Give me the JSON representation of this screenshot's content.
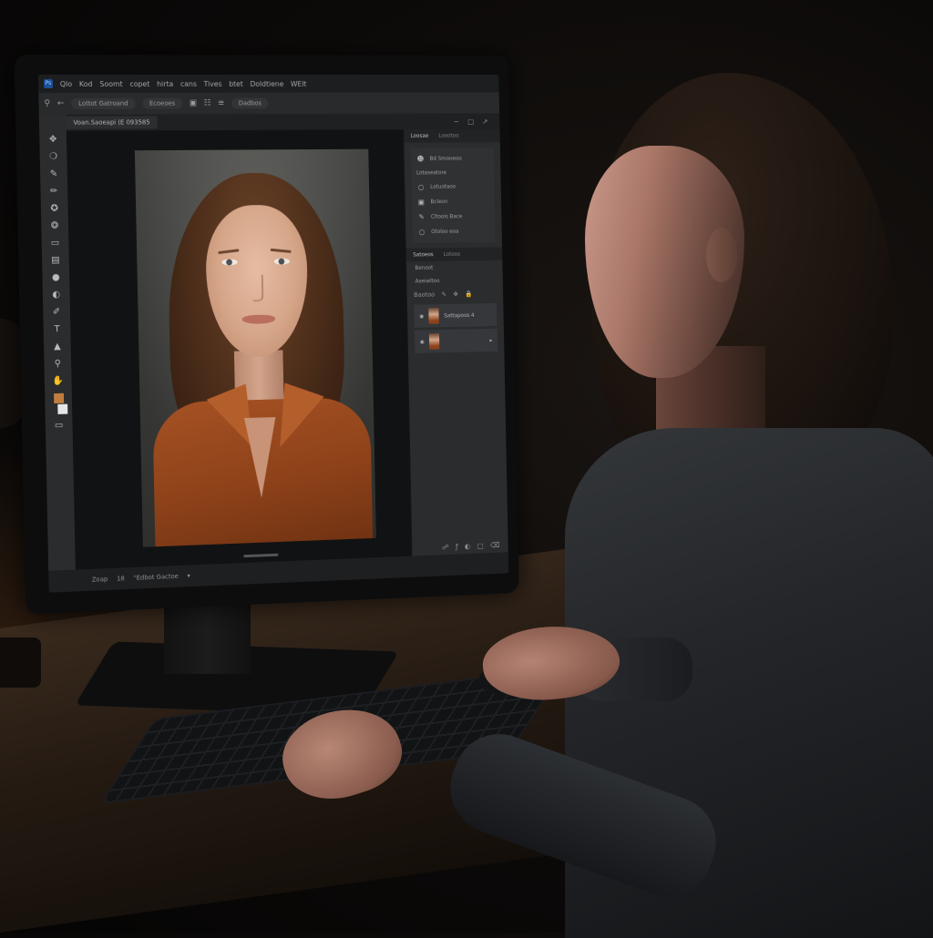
{
  "menubar": {
    "logo": "Ps",
    "items": [
      "Qlo",
      "Kod",
      "Soomt",
      "copet",
      "hirta",
      "cans",
      "Tives",
      "btet",
      "Doldtiene",
      "WElt"
    ]
  },
  "optionsbar": {
    "pill_1": "Lottot Gatroand",
    "pill_2": "Ecoeoes",
    "pill_3": "Dadbos"
  },
  "document": {
    "tab_title": "Voan.Saoeapi (E 093585"
  },
  "toolbar": {
    "tool_icons": [
      "move-icon",
      "lasso-icon",
      "brush-icon",
      "pencil-icon",
      "healing-icon",
      "clone-icon",
      "eraser-icon",
      "gradient-icon",
      "blur-icon",
      "dodge-icon",
      "pen-icon",
      "text-icon",
      "shape-icon",
      "zoom-icon",
      "hand-icon"
    ]
  },
  "panels": {
    "tab_1": "Loosae",
    "tab_2": "Loootoo",
    "header_row": "Bd Smooeoo",
    "section_label": "Lotaseatore",
    "rows": [
      "Lotuotaoo",
      "Bcleon",
      "Cltoois Bace",
      "Otoloo eoa"
    ],
    "tab_3": "Satoeos",
    "tab_4": "Lotoos",
    "row_a": "Benoot",
    "row_b": "Aseiwltoo",
    "layers_label": "Baotoo",
    "layer_1": "Sattapoos 4"
  },
  "statusbar": {
    "zoom": "Zoap",
    "value": "18",
    "info": "\"Edbot Gactoe"
  },
  "colors": {
    "accent": "#1d4f9a",
    "foreground_swatch": "#c17d3f",
    "background_swatch": "#e6e6e6",
    "shirt": "#9a4a1e"
  }
}
